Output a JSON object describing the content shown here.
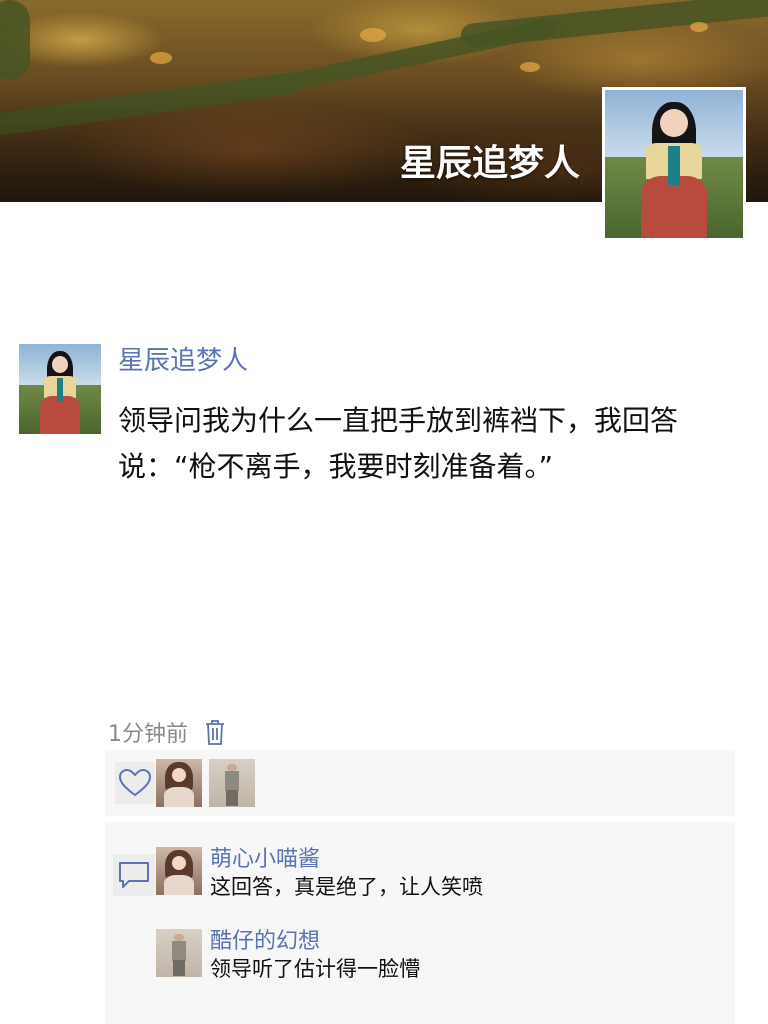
{
  "cover": {
    "display_name": "星辰追梦人"
  },
  "post": {
    "author": "星辰追梦人",
    "text": "领导问我为什么一直把手放到裤裆下，我回答说：“枪不离手，我要时刻准备着。”",
    "time": "1分钟前"
  },
  "likes": {
    "users": [
      "girl-avatar",
      "man-avatar"
    ]
  },
  "comments": [
    {
      "author": "萌心小喵酱",
      "text": "这回答，真是绝了，让人笑喷"
    },
    {
      "author": "酷仔的幻想",
      "text": "领导听了估计得一脸懵"
    }
  ],
  "colors": {
    "link": "#5a73b5",
    "text": "#111111",
    "muted": "#8a8a8a",
    "panel": "#f7f7f7"
  },
  "icons": [
    "trash-icon",
    "heart-icon",
    "comment-icon"
  ]
}
